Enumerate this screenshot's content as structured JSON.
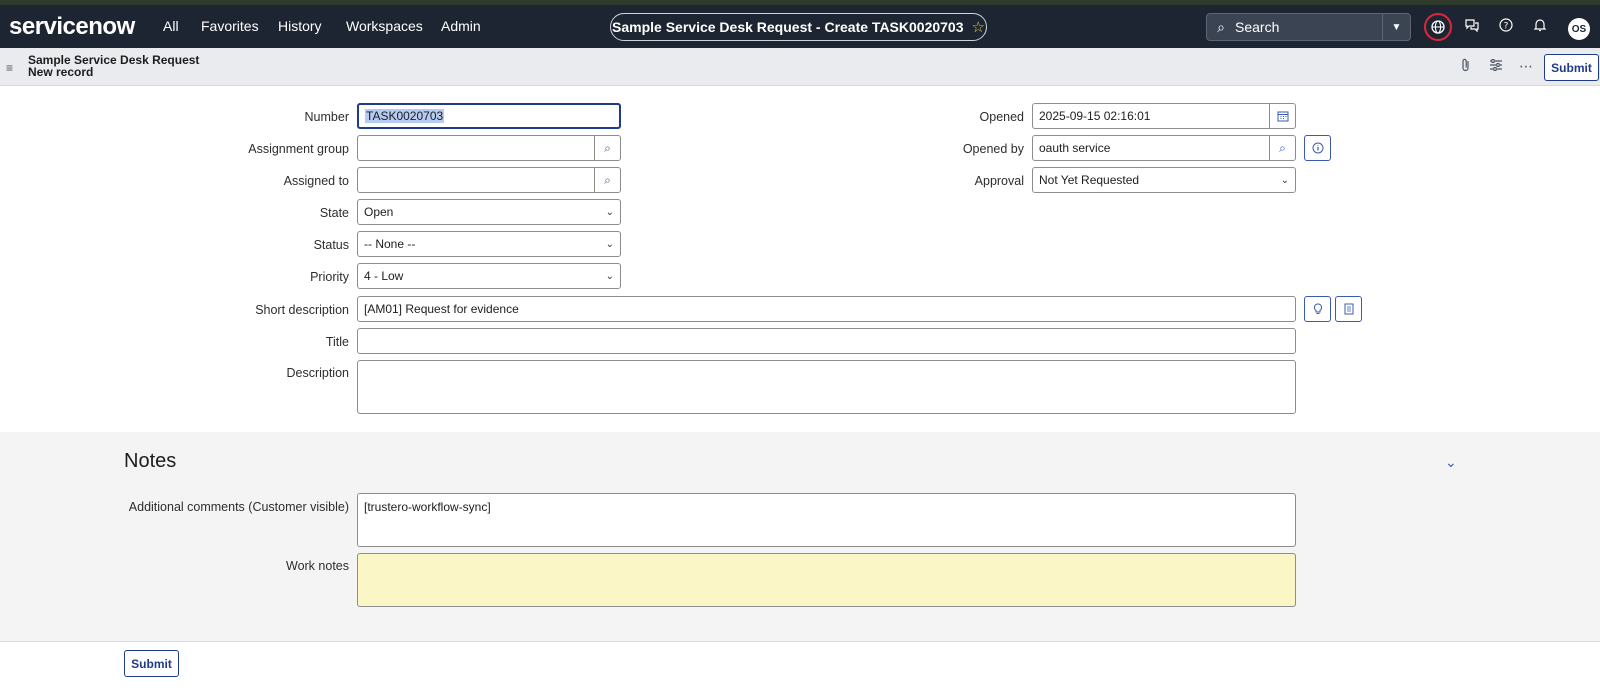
{
  "navbar": {
    "logo": "servicenow",
    "items": [
      "All",
      "Favorites",
      "History",
      "Workspaces",
      "Admin"
    ],
    "record_pill": "Sample Service Desk Request - Create TASK0020703",
    "search_placeholder": "Search",
    "avatar_initials": "OS",
    "icons": [
      "globe-icon",
      "chat-icon",
      "help-icon",
      "bell-icon"
    ]
  },
  "subheader": {
    "title": "Sample Service Desk Request",
    "subtitle": "New record",
    "submit_label": "Submit",
    "icons": [
      "paperclip-icon",
      "settings-sliders-icon",
      "more-icon"
    ]
  },
  "form": {
    "number_label": "Number",
    "number_value": "TASK0020703",
    "assignment_group_label": "Assignment group",
    "assignment_group_value": "",
    "assigned_to_label": "Assigned to",
    "assigned_to_value": "",
    "state_label": "State",
    "state_value": "Open",
    "status_label": "Status",
    "status_value": "-- None --",
    "priority_label": "Priority",
    "priority_value": "4 - Low",
    "short_description_label": "Short description",
    "short_description_value": "[AM01] Request for evidence",
    "title_label": "Title",
    "title_value": "",
    "description_label": "Description",
    "description_value": "",
    "opened_label": "Opened",
    "opened_value": "2025-09-15 02:16:01",
    "opened_by_label": "Opened by",
    "opened_by_value": "oauth service",
    "approval_label": "Approval",
    "approval_value": "Not Yet Requested"
  },
  "notes": {
    "section_title": "Notes",
    "additional_comments_label": "Additional comments (Customer visible)",
    "additional_comments_value": "[trustero-workflow-sync]",
    "work_notes_label": "Work notes",
    "work_notes_value": ""
  },
  "footer": {
    "submit_label": "Submit"
  },
  "colors": {
    "navbar_bg": "#1c2531",
    "accent": "#1f3c8a",
    "globe_ring": "#e0263b",
    "work_notes_bg": "#fbf6c5"
  }
}
